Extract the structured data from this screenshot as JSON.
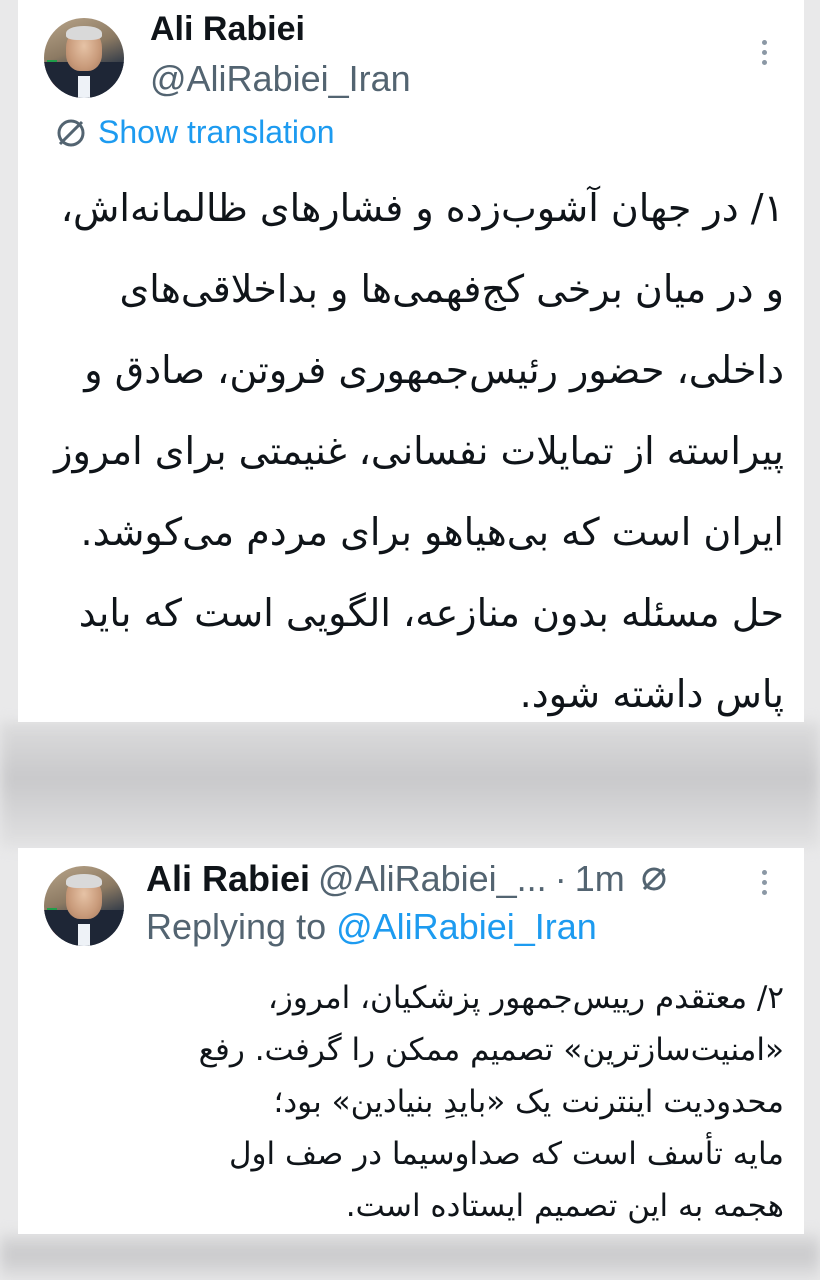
{
  "tweet1": {
    "author_name": "Ali Rabiei",
    "author_handle": "@AliRabiei_Iran",
    "translate_label": "Show translation",
    "text": "۱/ در جهان آشوب‌زده و فشارهای ظالمانه‌اش،\nو در میان برخی کج‌فهمی‌ها و  بداخلاقی‌های\nداخلی، حضور رئیس‌جمهوری فروتن، صادق و\nپیراسته از تمایلات نفسانی، غنیمتی برای امروز\nایران است که بی‌هیاهو برای مردم می‌کوشد.\nحل مسئله بدون منازعه، الگویی است که باید\nپاس داشته شود."
  },
  "tweet2": {
    "author_name": "Ali Rabiei",
    "author_handle": "@AliRabiei_...",
    "separator": "·",
    "time": "1m",
    "replying_prefix": "Replying to",
    "replying_handle": "@AliRabiei_Iran",
    "text": "۲/ معتقدم رییس‌جمهور پزشکیان، امروز،\n«امنیت‌سازترین» تصمیم ممکن را گرفت. رفع\nمحدودیت اینترنت یک «بایدِ بنیادین» بود؛\nمایه تأسف است که صداوسیما در صف اول\nهجمه به این تصمیم ایستاده است."
  },
  "icons": {
    "more": "more-vertical-icon",
    "translate": "translate-icon",
    "grok": "grok-icon"
  },
  "colors": {
    "accent": "#1d9bf0",
    "text": "#0f1419",
    "secondary": "#536471",
    "background": "#e9e9ea"
  }
}
